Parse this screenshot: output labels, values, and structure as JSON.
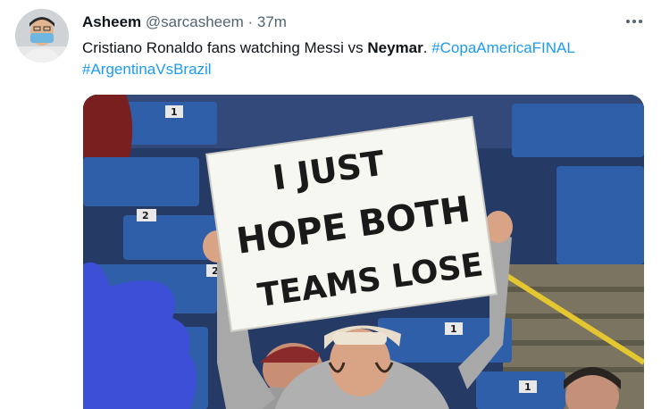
{
  "tweet": {
    "author_name": "Asheem",
    "handle": "@sarcasheem",
    "separator": "·",
    "time": "37m",
    "text_part1": "Cristiano Ronaldo fans watching Messi vs ",
    "text_bold": "Neymar",
    "text_part2": ". ",
    "hashtag1": "#CopaAmericaFINAL",
    "hashtag2": "#ArgentinaVsBrazil"
  },
  "image": {
    "sign_line1": "I JUST",
    "sign_line2": "HOPE BOTH",
    "sign_line3": "TEAMS LOSE",
    "seat_numbers": [
      "1",
      "2",
      "1",
      "2",
      "1"
    ]
  },
  "colors": {
    "link": "#1d9bf0",
    "seat_blue": "#2e5fa8"
  }
}
